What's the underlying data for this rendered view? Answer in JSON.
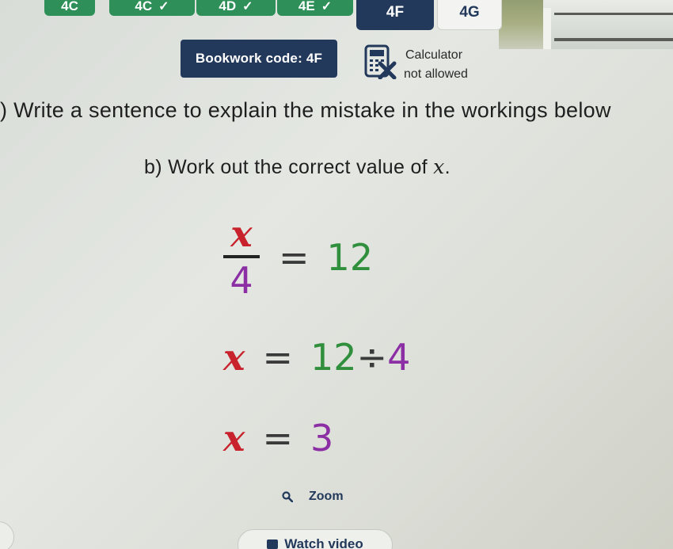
{
  "tabs": [
    {
      "label": "4C",
      "completed": true
    },
    {
      "label": "4D",
      "completed": true
    },
    {
      "label": "4E",
      "completed": true
    },
    {
      "label": "4F",
      "current": true
    },
    {
      "label": "4G"
    }
  ],
  "bookwork": {
    "label": "Bookwork code: 4F"
  },
  "calculator": {
    "line1": "Calculator",
    "line2": "not allowed"
  },
  "question": {
    "text": ") Write a sentence to explain the mistake in the workings below",
    "part_b_prefix": "b) Work out the correct value of",
    "part_b_var": "x",
    "part_b_suffix": "."
  },
  "workings": {
    "step1": {
      "numerator": "x",
      "denominator": "4",
      "equals": "=",
      "rhs": "12"
    },
    "step2": {
      "lhs": "x",
      "equals": "=",
      "rhs_num": "12",
      "op": "÷",
      "rhs_den": "4"
    },
    "step3": {
      "lhs": "x",
      "equals": "=",
      "rhs": "3"
    }
  },
  "zoom": {
    "label": "Zoom"
  },
  "watch_video": {
    "label": "Watch video"
  },
  "colors": {
    "navy": "#23395b",
    "tab_green": "#2f8f58",
    "var_red": "#c8232c",
    "num_green": "#2f8f3c",
    "den_purple": "#8c2fa5"
  }
}
